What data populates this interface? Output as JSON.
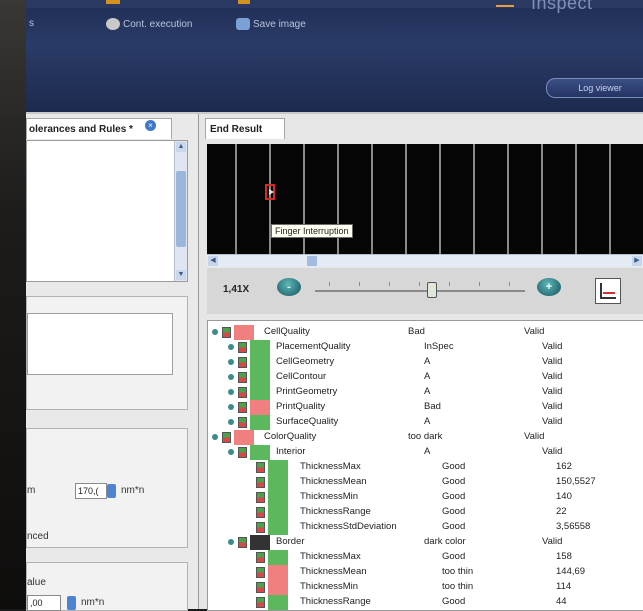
{
  "brand": "Inspect",
  "toolbar": {
    "cont_execution": "Cont. execution",
    "save_image": "Save image",
    "log_viewer": "Log viewer"
  },
  "left_panel": {
    "tab_title": "olerances and Rules *",
    "unit_label_1": "m",
    "value_1": "170,(",
    "unit_1": "nm*n",
    "label_advanced": "nced",
    "label_value": "alue",
    "value_2": ",00",
    "unit_2": "nm*n"
  },
  "right_panel": {
    "tab_title": "End Result",
    "tooltip": "Finger Interruption",
    "zoom": "1,41X",
    "zoom_out": "-",
    "zoom_in": "+"
  },
  "tree_rows": [
    {
      "name": "CellQuality",
      "value": "Bad",
      "extra": "Valid",
      "level": 0,
      "color": "#f08080"
    },
    {
      "name": "PlacementQuality",
      "value": "InSpec",
      "extra": "Valid",
      "level": 1,
      "color": "#5cb85c"
    },
    {
      "name": "CellGeometry",
      "value": "A",
      "extra": "Valid",
      "level": 1,
      "color": "#5cb85c"
    },
    {
      "name": "CellContour",
      "value": "A",
      "extra": "Valid",
      "level": 1,
      "color": "#5cb85c"
    },
    {
      "name": "PrintGeometry",
      "value": "A",
      "extra": "Valid",
      "level": 1,
      "color": "#5cb85c"
    },
    {
      "name": "PrintQuality",
      "value": "Bad",
      "extra": "Valid",
      "level": 1,
      "color": "#f08080"
    },
    {
      "name": "SurfaceQuality",
      "value": "A",
      "extra": "Valid",
      "level": 1,
      "color": "#5cb85c"
    },
    {
      "name": "ColorQuality",
      "value": "too dark",
      "extra": "Valid",
      "level": 0,
      "color": "#f08080"
    },
    {
      "name": "Interior",
      "value": "A",
      "extra": "Valid",
      "level": 1,
      "color": "#5cb85c"
    },
    {
      "name": "ThicknessMax",
      "value": "Good",
      "extra": "162",
      "level": 2,
      "color": "#5cb85c"
    },
    {
      "name": "ThicknessMean",
      "value": "Good",
      "extra": "150,5527",
      "level": 2,
      "color": "#5cb85c"
    },
    {
      "name": "ThicknessMin",
      "value": "Good",
      "extra": "140",
      "level": 2,
      "color": "#5cb85c"
    },
    {
      "name": "ThicknessRange",
      "value": "Good",
      "extra": "22",
      "level": 2,
      "color": "#5cb85c"
    },
    {
      "name": "ThicknessStdDeviation",
      "value": "Good",
      "extra": "3,56558",
      "level": 2,
      "color": "#5cb85c"
    },
    {
      "name": "Border",
      "value": "dark color",
      "extra": "Valid",
      "level": 1,
      "color": "#333333"
    },
    {
      "name": "ThicknessMax",
      "value": "Good",
      "extra": "158",
      "level": 2,
      "color": "#5cb85c"
    },
    {
      "name": "ThicknessMean",
      "value": "too thin",
      "extra": "144,69",
      "level": 2,
      "color": "#f08080"
    },
    {
      "name": "ThicknessMin",
      "value": "too thin",
      "extra": "114",
      "level": 2,
      "color": "#f08080"
    },
    {
      "name": "ThicknessRange",
      "value": "Good",
      "extra": "44",
      "level": 2,
      "color": "#5cb85c"
    }
  ]
}
